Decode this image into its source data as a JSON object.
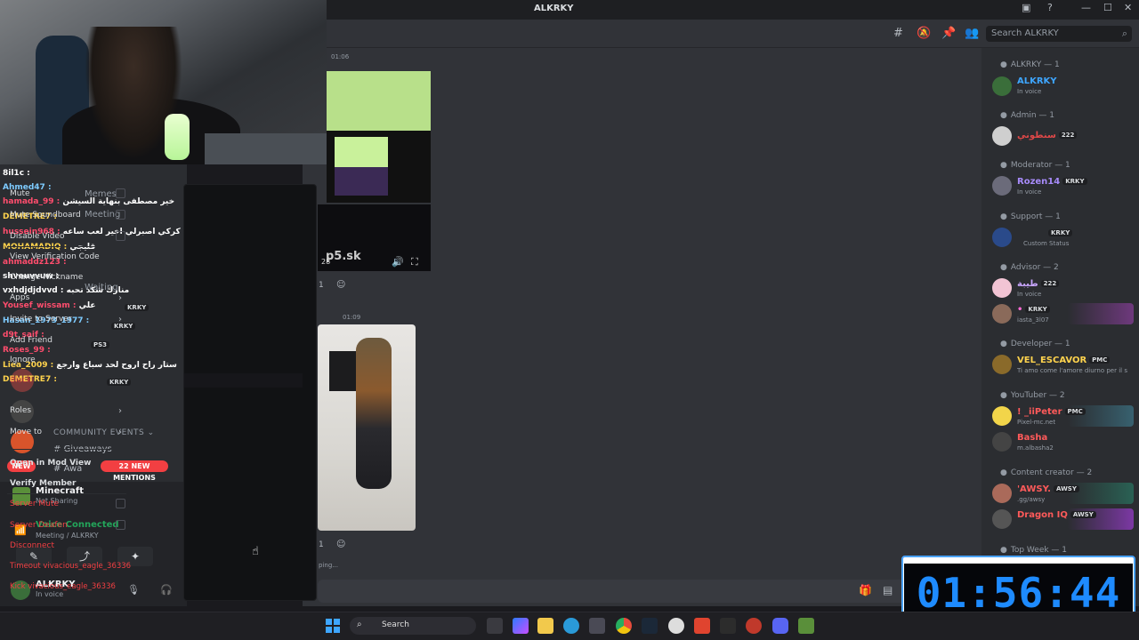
{
  "window": {
    "title": "ALKRKY",
    "controls": [
      "—",
      "☐",
      "✕"
    ]
  },
  "header": {
    "search_placeholder": "Search ALKRKY"
  },
  "overlay_chat": [
    {
      "name": "8il1c :",
      "msg": ""
    },
    {
      "name": "Ahmed47 :",
      "msg": ""
    },
    {
      "name": "hamada_99 :",
      "msg": "خير مصطفى بنهاية السيشن"
    },
    {
      "name": "DEMETRE7 :",
      "msg": ""
    },
    {
      "name": "hussein968 :",
      "msg": "كركي اصبرلي اخير لعب ساعه"
    },
    {
      "name": "MOHAMADIQ :",
      "msg": "قليجي"
    },
    {
      "name": "ahmaddz123 :",
      "msg": ""
    },
    {
      "name": "shveuvvuw :",
      "msg": ""
    },
    {
      "name": "vxhdjdjdvvd :",
      "msg": "منارك شكد تحبه"
    },
    {
      "name": "Yousef_wissam :",
      "msg": "علي"
    },
    {
      "name": "Hasan_1973_1977 :",
      "msg": ""
    },
    {
      "name": "d9t_saif :",
      "msg": ""
    },
    {
      "name": "Roses_99 :",
      "msg": ""
    },
    {
      "name": "Liea_2009 :",
      "msg": "ستار راح اروح لحد سباع وارجع"
    },
    {
      "name": "DEMETRE7 :",
      "msg": ""
    }
  ],
  "sidebar": {
    "channels": [
      "Memes",
      "Meeting",
      "Waiting"
    ],
    "voice_badges": [
      "KRKY",
      "KRKY",
      "PS3",
      "KRKY"
    ],
    "community_label": "COMMUNITY EVENTS",
    "giveaways": "Giveaways",
    "channel_tail": "Awa",
    "mentions": "22 NEW MENTIONS",
    "new_badge": "NEW"
  },
  "activity": {
    "game": "Minecraft",
    "game_status": "Not Sharing",
    "voice_title": "Voice Connected",
    "voice_sub": "Meeting / ALKRKY",
    "user_name": "ALKRKY",
    "user_status": "In voice"
  },
  "context_menu": {
    "items": [
      {
        "label": "Mute",
        "type": "check"
      },
      {
        "label": "Mute Soundboard",
        "type": "check"
      },
      {
        "label": "Disable Video",
        "type": "check"
      },
      {
        "label": "View Verification Code",
        "type": "plain"
      },
      {
        "label": "Change Nickname",
        "type": "plain"
      },
      {
        "label": "Apps",
        "type": "sub"
      },
      {
        "label": "Invite to Server",
        "type": "sub"
      },
      {
        "label": "Add Friend",
        "type": "plain"
      },
      {
        "label": "Ignore",
        "type": "plain"
      },
      {
        "label": "Block",
        "type": "red-dim"
      },
      {
        "label": "Roles",
        "type": "sub"
      },
      {
        "label": "Move to",
        "type": "sub"
      },
      {
        "label": "Open in Mod View",
        "type": "bold"
      },
      {
        "label": "Verify Member",
        "type": "bold"
      },
      {
        "label": "Server Mute",
        "type": "red-check"
      },
      {
        "label": "Server Deafen",
        "type": "red-check"
      },
      {
        "label": "Disconnect",
        "type": "red"
      },
      {
        "label": "Timeout vivacious_eagle_36336",
        "type": "red"
      },
      {
        "label": "Kick vivacious_eagle_36336",
        "type": "red"
      }
    ]
  },
  "chat": {
    "timestamp1": "01:06",
    "timestamp2": "01:09",
    "video_label": "p5.sk",
    "video_time": "28",
    "react_count1": "1",
    "react_count2": "1",
    "typing": "ping..."
  },
  "members": {
    "groups": [
      {
        "role": "ALKRKY — 1",
        "members": [
          {
            "name": "ALKRKY",
            "sub": "In voice",
            "color": "#3ea6ff",
            "badge": ""
          }
        ]
      },
      {
        "role": "Admin — 1",
        "members": [
          {
            "name": "سنطوني",
            "sub": "",
            "color": "#e04848",
            "badge": "222"
          }
        ]
      },
      {
        "role": "Moderator — 1",
        "members": [
          {
            "name": "Rozen14",
            "sub": "In voice",
            "color": "#a78bfa",
            "badge": "KRKY"
          }
        ]
      },
      {
        "role": "Support — 1",
        "members": [
          {
            "name": "",
            "sub": "Custom Status",
            "color": "#3ea6ff",
            "badge": "KRKY"
          }
        ]
      },
      {
        "role": "Advisor — 2",
        "members": [
          {
            "name": "طيبة",
            "sub": "In voice",
            "color": "#c9a6ff",
            "badge": "222"
          },
          {
            "name": "•",
            "sub": "iasta_3l07",
            "color": "#ff6ad5",
            "badge": "KRKY"
          }
        ]
      },
      {
        "role": "Developer — 1",
        "members": [
          {
            "name": "VEL_ESCAVOR",
            "sub": "Ti amo come l'amore diurno per il s",
            "color": "#ffd34d",
            "badge": "PMC"
          }
        ]
      },
      {
        "role": "YouTuber — 2",
        "members": [
          {
            "name": "! _iiPeter",
            "sub": "Pixel-mc.net",
            "color": "#ff5a5a",
            "badge": "PMC"
          },
          {
            "name": "Basha",
            "sub": "m.albasha2",
            "color": "#ff5a5a",
            "badge": ""
          }
        ]
      },
      {
        "role": "Content creator — 2",
        "members": [
          {
            "name": "'AWSY.",
            "sub": ".gg/awsy",
            "color": "#ff5a5a",
            "badge": "AWSY"
          },
          {
            "name": "Dragon IQ",
            "sub": "",
            "color": "#ff5a5a",
            "badge": "AWSY"
          }
        ]
      },
      {
        "role": "Top Week — 1",
        "members": []
      }
    ]
  },
  "timer": {
    "value": "01:56:44"
  },
  "taskbar": {
    "search": "Search"
  },
  "colors": {
    "accent": "#5865f2",
    "danger": "#f23f42",
    "online": "#23a55a",
    "timer": "#1e8bff"
  }
}
